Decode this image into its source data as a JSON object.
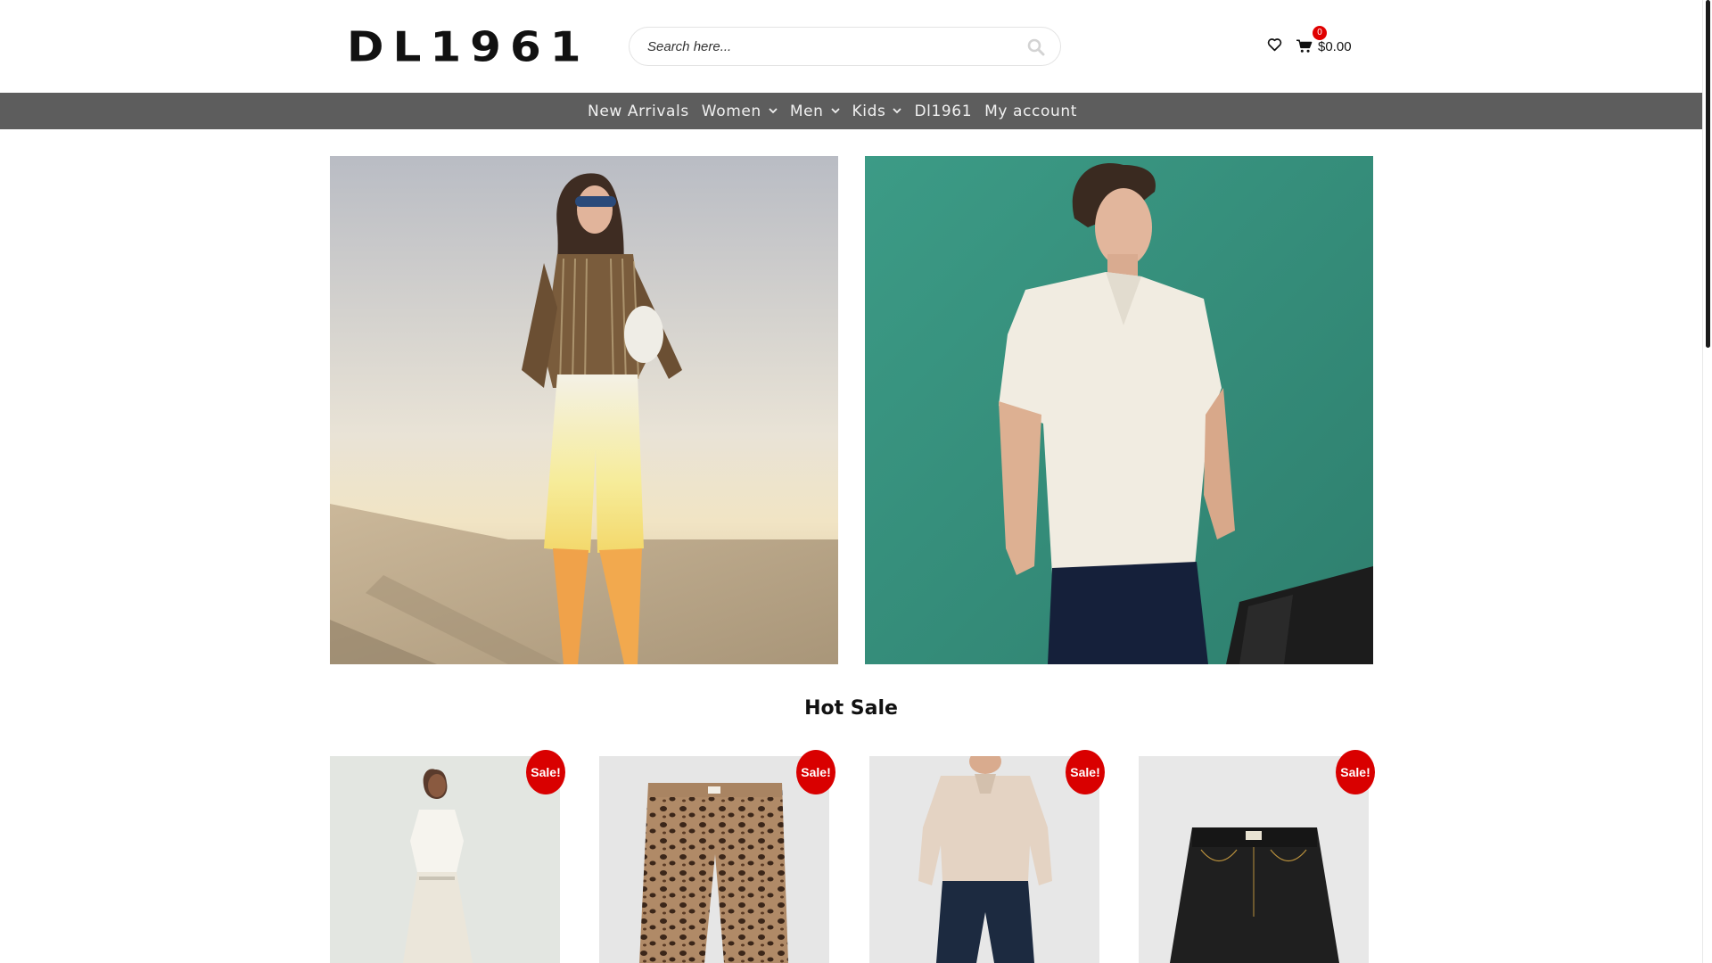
{
  "brand": {
    "logo_text": "DL1961"
  },
  "search": {
    "placeholder": "Search here...",
    "value": ""
  },
  "cart": {
    "count": "0",
    "total": "$0.00"
  },
  "nav": {
    "items": [
      {
        "label": "New Arrivals",
        "has_dropdown": false
      },
      {
        "label": "Women",
        "has_dropdown": true
      },
      {
        "label": "Men",
        "has_dropdown": true
      },
      {
        "label": "Kids",
        "has_dropdown": true
      },
      {
        "label": "Dl1961",
        "has_dropdown": false
      },
      {
        "label": "My account",
        "has_dropdown": false
      }
    ]
  },
  "sections": {
    "hot_sale_title": "Hot Sale"
  },
  "products": [
    {
      "badge": "Sale!"
    },
    {
      "badge": "Sale!"
    },
    {
      "badge": "Sale!"
    },
    {
      "badge": "Sale!"
    }
  ],
  "icons": {
    "search": "search-icon",
    "wishlist": "heart-icon",
    "cart": "shopping-cart-icon",
    "dropdown": "chevron-down-icon"
  },
  "colors": {
    "nav_background": "#5d5d5d",
    "sale_badge": "#d90000",
    "cart_count_badge": "#e00000",
    "hero_men_background": "#3e9a85"
  }
}
